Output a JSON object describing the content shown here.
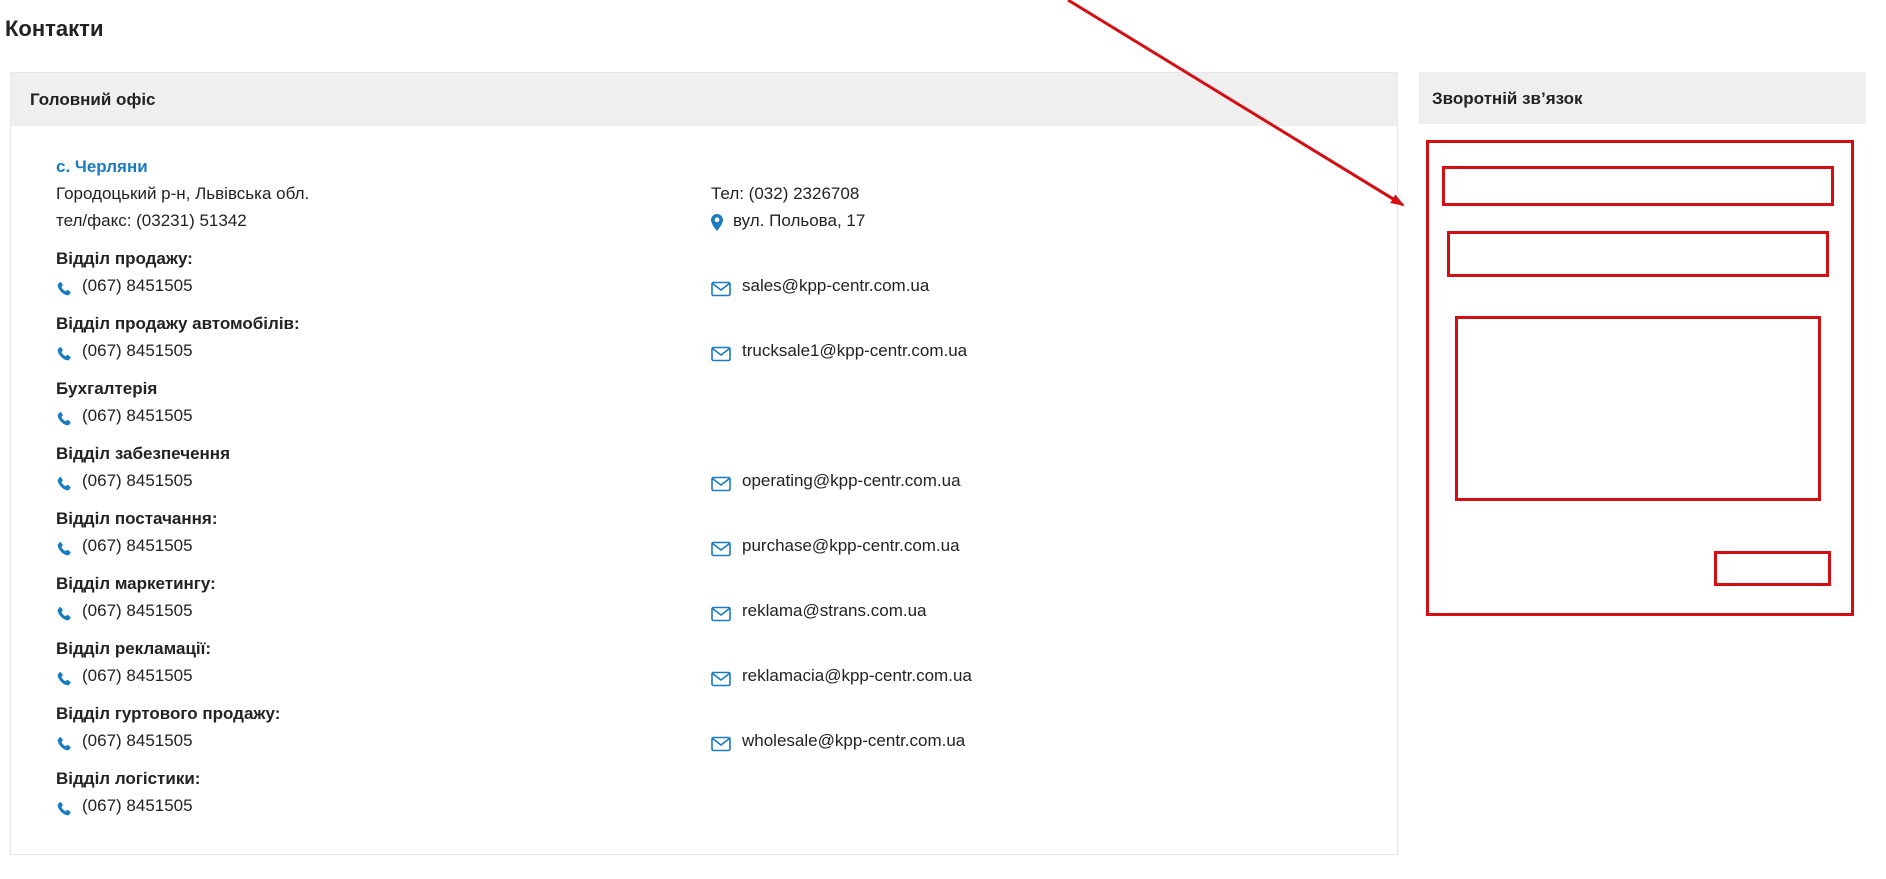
{
  "page": {
    "title": "Контакти"
  },
  "office": {
    "header": "Головний офіс",
    "city": "с. Черляни",
    "region": "Городоцький р-н, Львівська обл.",
    "fax": "тел/факс: (03231) 51342",
    "phone": "Тел: (032) 2326708",
    "address": "вул. Польова, 17",
    "departments": [
      {
        "name": "Відділ продажу:",
        "phone": "(067) 8451505",
        "email": "sales@kpp-centr.com.ua"
      },
      {
        "name": "Відділ продажу автомобілів:",
        "phone": "(067) 8451505",
        "email": "trucksale1@kpp-centr.com.ua"
      },
      {
        "name": "Бухгалтерія",
        "phone": "(067) 8451505",
        "email": ""
      },
      {
        "name": "Відділ забезпечення",
        "phone": "(067) 8451505",
        "email": "operating@kpp-centr.com.ua"
      },
      {
        "name": "Відділ постачання:",
        "phone": "(067) 8451505",
        "email": "purchase@kpp-centr.com.ua"
      },
      {
        "name": "Відділ маркетингу:",
        "phone": "(067) 8451505",
        "email": "reklama@strans.com.ua"
      },
      {
        "name": "Відділ рекламації:",
        "phone": "(067) 8451505",
        "email": "reklamacia@kpp-centr.com.ua"
      },
      {
        "name": "Відділ гуртового продажу:",
        "phone": "(067) 8451505",
        "email": "wholesale@kpp-centr.com.ua"
      },
      {
        "name": "Відділ логістики:",
        "phone": "(067) 8451505",
        "email": ""
      }
    ]
  },
  "feedback": {
    "header": "Зворотній зв’язок"
  },
  "colors": {
    "link_blue": "#1a7bbf",
    "annotation_red": "#d40f14",
    "panel_gray": "#efefef"
  },
  "icons": {
    "phone": "phone-icon",
    "email": "mail-icon",
    "address": "map-pin-icon"
  }
}
